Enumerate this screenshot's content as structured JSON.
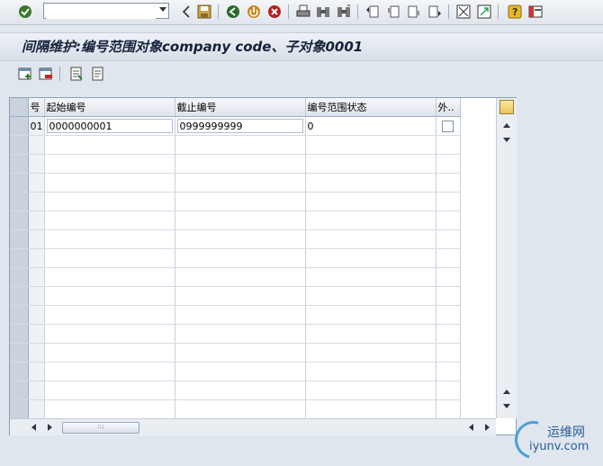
{
  "toolbar": {
    "icons": [
      "enter-icon",
      "back-icon",
      "save-icon",
      "back-nav-icon",
      "exit-icon",
      "cancel-icon",
      "print-icon",
      "find-icon",
      "find-next-icon",
      "first-page-icon",
      "prev-page-icon",
      "next-page-icon",
      "last-page-icon",
      "new-session-icon",
      "shortcut-icon",
      "help-icon",
      "layout-icon"
    ],
    "command_field_value": ""
  },
  "title": "间隔维护:编号范围对象company code、子对象0001",
  "app_toolbar": {
    "icons": [
      "insert-interval-icon",
      "delete-interval-icon",
      "change-status-icon",
      "overview-icon"
    ]
  },
  "grid": {
    "columns": [
      "号",
      "起始编号",
      "截止编号",
      "编号范围状态",
      "外.."
    ],
    "rows": [
      {
        "no": "01",
        "from": "0000000001",
        "to": "0999999999",
        "status": "0",
        "ext": false
      }
    ],
    "empty_rows": 15
  },
  "watermark": {
    "cn": "运维网",
    "url": "iyunv.com"
  }
}
